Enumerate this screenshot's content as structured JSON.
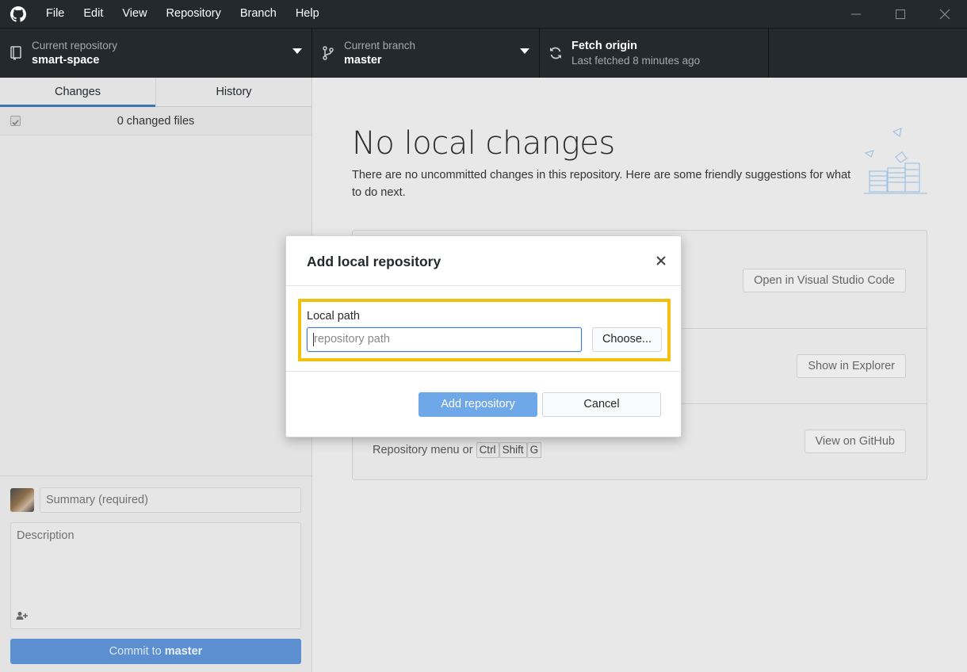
{
  "app": {
    "name": "GitHub Desktop"
  },
  "menubar": {
    "items": [
      "File",
      "Edit",
      "View",
      "Repository",
      "Branch",
      "Help"
    ],
    "logo_icon": "github-octocat-icon"
  },
  "window_controls": {
    "minimize_icon": "minimize-icon",
    "maximize_icon": "maximize-icon",
    "close_icon": "close-icon"
  },
  "toolbar": {
    "repo": {
      "description": "Current repository",
      "title": "smart-space",
      "icon": "repo-icon"
    },
    "branch": {
      "description": "Current branch",
      "title": "master",
      "icon": "git-branch-icon"
    },
    "fetch": {
      "title": "Fetch origin",
      "description": "Last fetched 8 minutes ago",
      "icon": "sync-icon"
    }
  },
  "sidebar": {
    "tabs": [
      {
        "label": "Changes",
        "selected": true
      },
      {
        "label": "History",
        "selected": false
      }
    ],
    "changed_files_label": "0 changed files",
    "commit": {
      "summary_placeholder": "Summary (required)",
      "description_placeholder": "Description",
      "button_prefix": "Commit to ",
      "button_branch": "master"
    }
  },
  "main": {
    "title": "No local changes",
    "text": "There are no uncommitted changes in this repository. Here are some friendly suggestions for what to do next.",
    "suggestions": [
      {
        "button": "Open in Visual Studio Code"
      },
      {
        "button": "Show in Explorer"
      },
      {
        "button": "View on GitHub",
        "sub_text": "Repository menu or",
        "keys": [
          "Ctrl",
          "Shift",
          "G"
        ]
      }
    ]
  },
  "dialog": {
    "title": "Add local repository",
    "local_path_label": "Local path",
    "local_path_placeholder": "repository path",
    "local_path_value": "",
    "choose_label": "Choose...",
    "add_label": "Add repository",
    "cancel_label": "Cancel",
    "highlight_color": "#f2c10f"
  },
  "colors": {
    "titlebar": "#24292e",
    "accent": "#3f75b5",
    "primary_button": "#6ea8e8"
  }
}
